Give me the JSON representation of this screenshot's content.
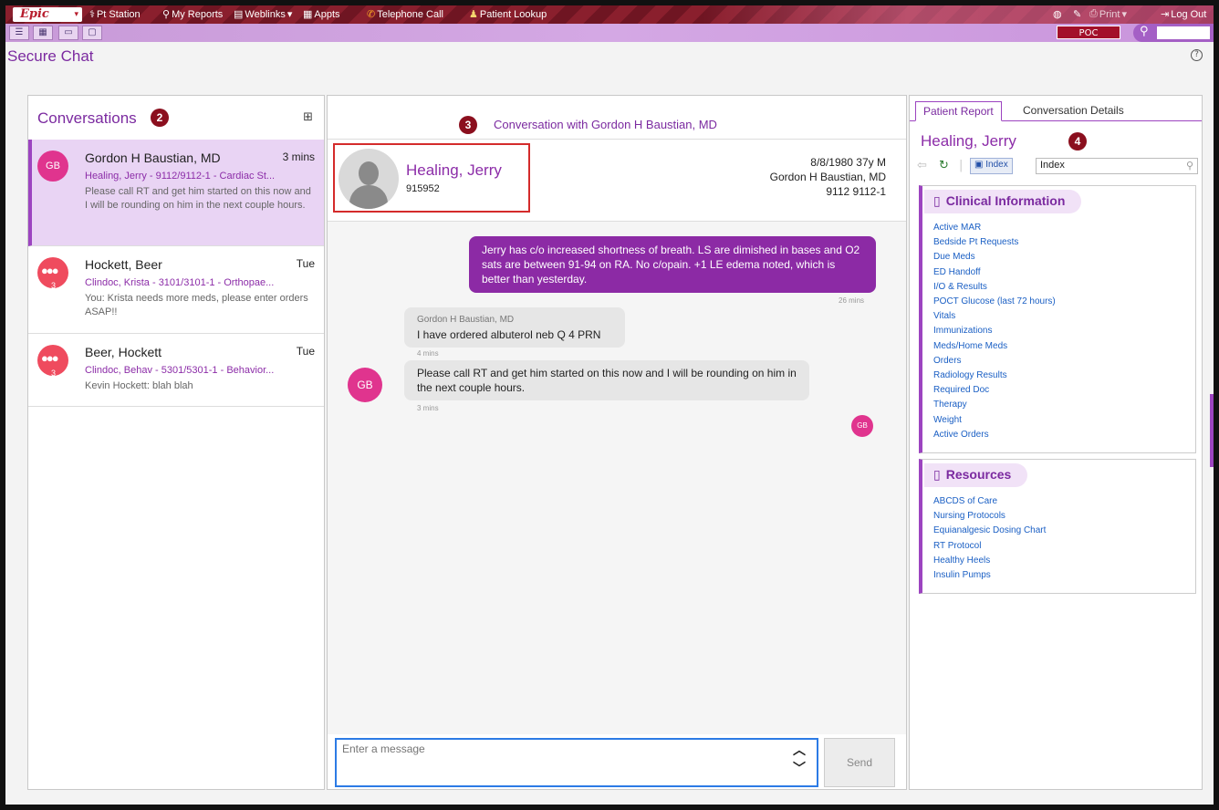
{
  "topbar": {
    "logo": "Epic",
    "items": [
      {
        "icon": "pt-station-icon",
        "label": "Pt Station"
      },
      {
        "icon": "search-icon",
        "label": "My Reports"
      },
      {
        "icon": "book-icon",
        "label": "Weblinks"
      },
      {
        "icon": "appointments-icon",
        "label": "Appts"
      },
      {
        "icon": "phone-icon",
        "label": "Telephone Call"
      },
      {
        "icon": "person-icon",
        "label": "Patient Lookup"
      }
    ],
    "right": {
      "print": "Print",
      "logout": "Log Out"
    }
  },
  "toolbar2": {
    "poc": "POC"
  },
  "page": {
    "title": "Secure Chat",
    "help": "?"
  },
  "badges": {
    "b2": "2",
    "b3": "3",
    "b4": "4"
  },
  "conversations": {
    "header": "Conversations",
    "items": [
      {
        "avatar": "GB",
        "name": "Gordon H Baustian, MD",
        "time": "3 mins",
        "subtitle": "Healing, Jerry - 9112/9112-1 - Cardiac St...",
        "preview": "Please call RT and get him started on this now and I will be rounding on him in the next couple hours."
      },
      {
        "avatar_count": "3",
        "name": "Hockett, Beer",
        "time": "Tue",
        "subtitle": "Clindoc, Krista - 3101/3101-1 - Orthopae...",
        "preview": "You: Krista needs more meds, please enter orders ASAP!!"
      },
      {
        "avatar_count": "3",
        "name": "Beer, Hockett",
        "time": "Tue",
        "subtitle": "Clindoc, Behav - 5301/5301-1 - Behavior...",
        "preview": "Kevin Hockett: blah blah"
      }
    ]
  },
  "chat": {
    "title": "Conversation with Gordon H Baustian, MD",
    "patient": {
      "name": "Healing, Jerry",
      "mrn": "915952",
      "dob_age_sex": "8/8/1980 37y M",
      "provider": "Gordon H Baustian, MD",
      "room": "9112 9112-1"
    },
    "messages": {
      "outgoing_text": "Jerry has c/o increased shortness of breath.  LS are dimished in bases and O2 sats are between 91-94 on RA. No c/opain. +1 LE edema noted, which is better than yesterday.",
      "outgoing_time": "26 mins",
      "incoming1_sender": "Gordon H Baustian, MD",
      "incoming1_text": "I have ordered albuterol neb Q 4 PRN",
      "incoming1_time": "4 mins",
      "incoming2_text": "Please call RT and get him started on this now and I will be rounding on him in the next couple hours.",
      "incoming2_time": "3 mins",
      "avatar": "GB",
      "read_avatar": "GB"
    },
    "composer": {
      "placeholder": "Enter a message",
      "send": "Send"
    }
  },
  "report": {
    "tabs": [
      "Patient Report",
      "Conversation Details"
    ],
    "patient_name": "Healing, Jerry",
    "index_button": "Index",
    "index_value": "Index",
    "clinical": {
      "title": "Clinical Information",
      "links": [
        "Active MAR",
        "Bedside Pt Requests",
        "Due Meds",
        "ED Handoff",
        "I/O & Results",
        "POCT Glucose (last 72 hours)",
        "Vitals",
        "Immunizations",
        "Meds/Home Meds",
        "Orders",
        "Radiology Results",
        "Required Doc",
        "Therapy",
        "Weight",
        "Active Orders"
      ]
    },
    "resources": {
      "title": "Resources",
      "links": [
        "ABCDS of Care",
        "Nursing Protocols",
        "Equianalgesic Dosing Chart",
        "RT Protocol",
        "Healthy Heels",
        "Insulin Pumps"
      ]
    }
  }
}
